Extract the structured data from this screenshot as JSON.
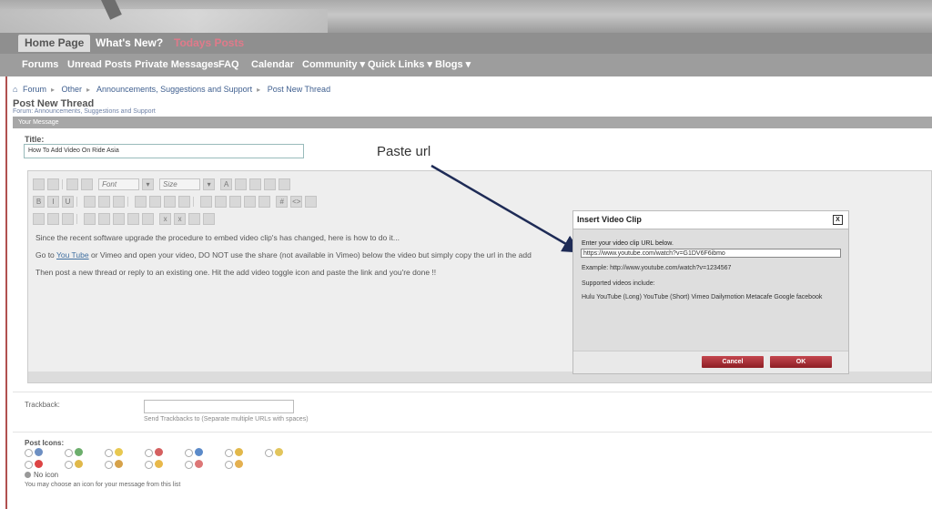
{
  "nav": {
    "tabs": [
      {
        "label": "Home Page"
      },
      {
        "label": "What's New?"
      },
      {
        "label": "Todays Posts"
      }
    ],
    "sub": [
      {
        "label": "Forums"
      },
      {
        "label": "Unread Posts"
      },
      {
        "label": "Private Messages"
      },
      {
        "label": "FAQ"
      },
      {
        "label": "Calendar"
      },
      {
        "label": "Community ▾"
      },
      {
        "label": "Quick Links ▾"
      },
      {
        "label": "Blogs ▾"
      }
    ]
  },
  "breadcrumb": [
    "Forum",
    "Other",
    "Announcements, Suggestions and Support",
    "Post New Thread"
  ],
  "page": {
    "title": "Post New Thread",
    "forum_line": "Forum: Announcements, Suggestions and Support",
    "section": "Your Message"
  },
  "form": {
    "title_label": "Title:",
    "title_value": "How To Add Video On Ride Asia",
    "toolbar": {
      "font": "Font",
      "size": "Size"
    },
    "body": {
      "p1": "Since the recent software upgrade the procedure to embed video clip's has changed, here is how to do it...",
      "p2a": "Go to ",
      "p2link": "You Tube",
      "p2b": " or Vimeo and open your video, DO NOT use the share (not available in Vimeo) below the video but simply copy the url in the add",
      "p3": "Then post a new thread or reply to an existing one. Hit the add video toggle icon and paste the link and you're done !!"
    }
  },
  "annotation": {
    "text": "Paste url"
  },
  "dialog": {
    "title": "Insert Video Clip",
    "close": "X",
    "prompt": "Enter your video clip URL below.",
    "url_value": "https://www.youtube.com/watch?v=G1DV6F6ibmo",
    "example": "Example: http://www.youtube.com/watch?v=1234567",
    "supported_label": "Supported videos include:",
    "supported_list": "Hulu YouTube (Long) YouTube (Short) Vimeo Dailymotion Metacafe Google facebook",
    "cancel": "Cancel",
    "ok": "OK"
  },
  "trackback": {
    "label": "Trackback:",
    "hint": "Send Trackbacks to (Separate multiple URLs with spaces)"
  },
  "post_icons": {
    "label": "Post Icons:",
    "no_icon": "No icon",
    "hint": "You may choose an icon for your message from this list",
    "colors": [
      "#6d8fc2",
      "#6cae6c",
      "#e8c850",
      "#d56060",
      "#5b8ac9",
      "#e2b84a",
      "#e2c55c",
      "#d44",
      "#e0b84a",
      "#d6a24a",
      "#e8b84a",
      "#d77",
      "#e4b050"
    ]
  }
}
